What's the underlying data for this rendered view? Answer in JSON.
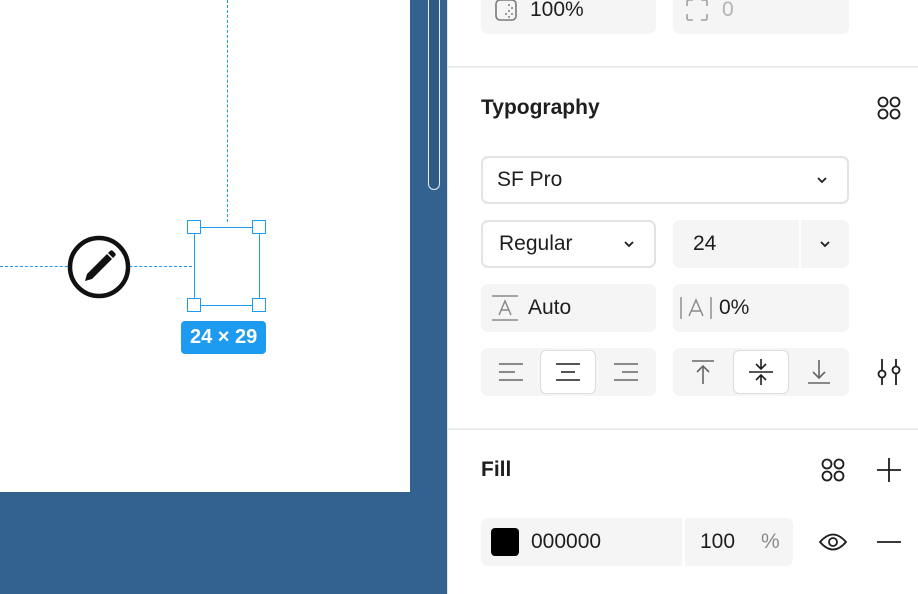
{
  "canvas": {
    "selection_size": "24 × 29",
    "accent_color": "#1d9bf0",
    "background_color": "#336291"
  },
  "layer": {
    "opacity_value": "100%",
    "radius_value": "0"
  },
  "typography": {
    "title": "Typography",
    "font_family": "SF Pro",
    "font_weight": "Regular",
    "font_size": "24",
    "line_height": "Auto",
    "letter_spacing": "0%",
    "horizontal_align_active": "center",
    "vertical_align_active": "middle"
  },
  "fill": {
    "title": "Fill",
    "hex": "000000",
    "opacity": "100",
    "opacity_unit": "%",
    "swatch_color": "#000000"
  }
}
